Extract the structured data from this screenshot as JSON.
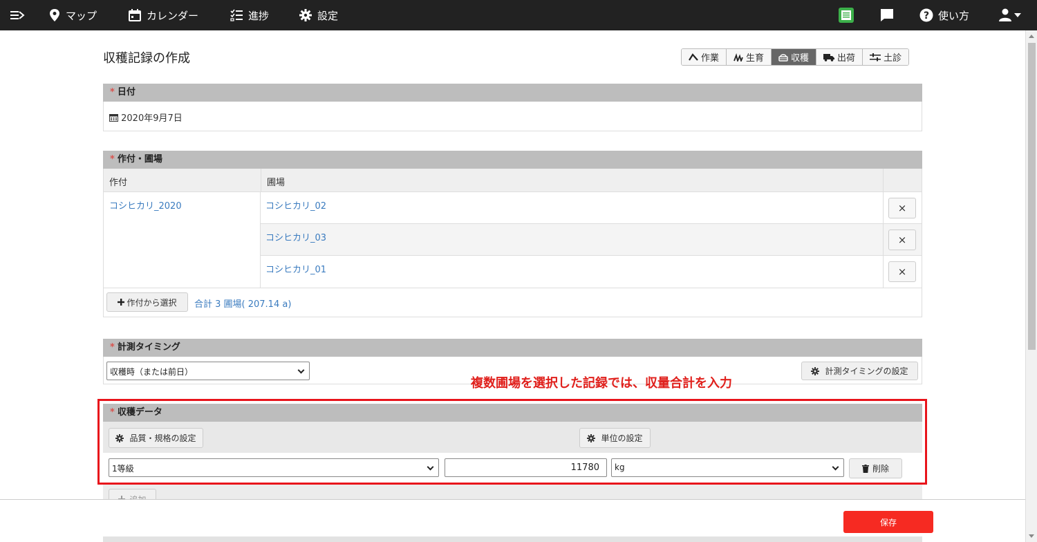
{
  "nav": {
    "map": "マップ",
    "calendar": "カレンダー",
    "progress": "進捗",
    "settings": "設定",
    "help": "使い方"
  },
  "page": {
    "title": "収穫記録の作成"
  },
  "record_tabs": [
    {
      "label": "作業",
      "active": false
    },
    {
      "label": "生育",
      "active": false
    },
    {
      "label": "収穫",
      "active": true
    },
    {
      "label": "出荷",
      "active": false
    },
    {
      "label": "土診",
      "active": false
    }
  ],
  "date_section": {
    "required_mark": "*",
    "title": "日付",
    "value": "2020年9月7日"
  },
  "crop_section": {
    "required_mark": "*",
    "title": "作付・圃場",
    "col_crop": "作付",
    "col_field": "圃場",
    "crop_name": "コシヒカリ_2020",
    "fields": [
      "コシヒカリ_02",
      "コシヒカリ_03",
      "コシヒカリ_01"
    ],
    "remove_label": "×",
    "select_button": "作付から選択",
    "total_text": "合計 3 圃場( 207.14 a)"
  },
  "timing_section": {
    "required_mark": "*",
    "title": "計測タイミング",
    "selected": "収穫時（または前日）",
    "setting_button": "計測タイミングの設定"
  },
  "annotation": "複数圃場を選択した記録では、収量合計を入力",
  "harvest_section": {
    "required_mark": "*",
    "title": "収穫データ",
    "quality_button": "品質・規格の設定",
    "unit_button": "単位の設定",
    "grade": "1等級",
    "quantity": "11780",
    "unit": "kg",
    "delete_button": "削除",
    "add_button": "追加"
  },
  "footer": {
    "save_button": "保存"
  },
  "colors": {
    "nav_bg": "#222222",
    "accent_red": "#f62a22",
    "highlight_red": "#e8141b",
    "link_blue": "#3a7bbf"
  }
}
